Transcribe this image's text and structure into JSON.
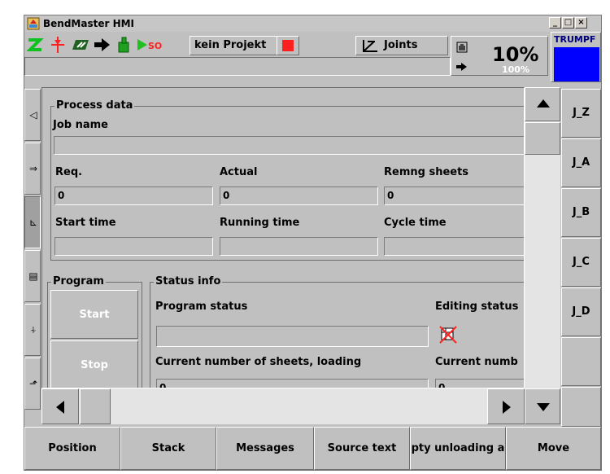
{
  "window": {
    "title": "BendMaster HMI",
    "controls": [
      "_",
      "□",
      "×"
    ]
  },
  "toolbar": {
    "project_label": "kein Projekt",
    "joints_label": "Joints",
    "override_percent": "10%",
    "override_sub": "100%",
    "brand": "TRUMPF",
    "brand_color": "#0000ff",
    "icons": [
      "axis-z-green-icon",
      "red-pendulum-icon",
      "green-speed-icon",
      "arrow-right-icon",
      "bottle-icon",
      "play-so-icon",
      "stop-red-icon",
      "joints-axes-icon",
      "hand-icon",
      "arrow-small-icon"
    ]
  },
  "left_tabs": [
    {
      "icon": "tab-arrow-left-icon",
      "glyph": "◁"
    },
    {
      "icon": "tab-enter-icon",
      "glyph": "⇒"
    },
    {
      "icon": "tab-axes-icon",
      "glyph": "⊾"
    },
    {
      "icon": "tab-keyboard-icon",
      "glyph": "▤"
    },
    {
      "icon": "tab-balance-icon",
      "glyph": "⍭"
    },
    {
      "icon": "tab-bend-icon",
      "glyph": "⬏"
    }
  ],
  "process_data": {
    "legend": "Process data",
    "job_name_label": "Job name",
    "job_name_value": "",
    "req_label": "Req.",
    "req_value": "0",
    "actual_label": "Actual",
    "actual_value": "0",
    "remng_label": "Remng sheets",
    "remng_value": "0",
    "start_time_label": "Start time",
    "start_time_value": "",
    "running_time_label": "Running time",
    "running_time_value": "",
    "cycle_time_label": "Cycle time",
    "cycle_time_value": ""
  },
  "program": {
    "legend": "Program",
    "start_label": "Start",
    "stop_label": "Stop"
  },
  "status_info": {
    "legend": "Status info",
    "program_status_label": "Program status",
    "program_status_value": "",
    "editing_status_label": "Editing status",
    "current_sheets_loading_label": "Current number of sheets, loading",
    "current_sheets_loading_value": "0",
    "current_numb_label": "Current numb",
    "current_numb_value": "0"
  },
  "right_tabs": [
    "J_Z",
    "J_A",
    "J_B",
    "J_C",
    "J_D",
    ""
  ],
  "bottom_buttons": [
    "Position",
    "Stack",
    "Messages",
    "Source text",
    "pty unloading a",
    "Move"
  ],
  "colors": {
    "panel": "#c0c0c0",
    "scroll_track": "#e4e4e4",
    "stop_red": "#ff2020"
  }
}
